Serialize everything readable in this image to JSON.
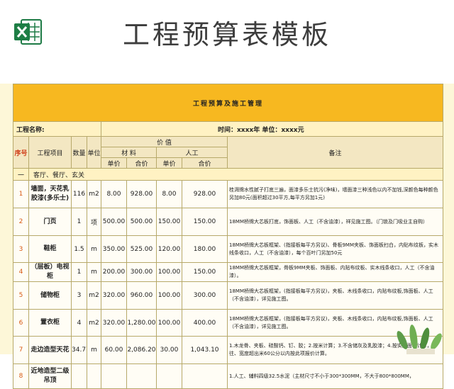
{
  "header": {
    "title": "工程预算表模板",
    "app_icon": "excel-icon"
  },
  "sheet": {
    "title": "工程预算及施工管理",
    "project_label": "工程名称:",
    "info_right": "时间：xxxx年    单位：xxxx元",
    "columns": {
      "seq": "序号",
      "item": "工程项目",
      "qty": "数量",
      "unit": "单位",
      "value": "价          值",
      "material": "材          料",
      "labor": "人工",
      "unit_price": "单价",
      "total": "合价",
      "note": "备注"
    },
    "section_label": "一",
    "section_name": "客厅、餐厅、玄关",
    "rows": [
      {
        "seq": "1",
        "name": "墙面，天花乳胶漆(多乐士)",
        "qty": "116",
        "unit": "m2",
        "mat_price": "8.00",
        "mat_total": "928.00",
        "lab_price": "8.00",
        "lab_total": "928.00",
        "note": "桂湃牌水性腻子打底三遍，面漆多乐士抗污(净味)，墙面漆三种浅色以内不加钱,深颜色每种颜色另加80元(面积超过30平方,每平方另加1元)"
      },
      {
        "seq": "2",
        "name": "门页",
        "qty": "1",
        "unit": "项",
        "mat_price": "500.00",
        "mat_total": "500.00",
        "lab_price": "150.00",
        "lab_total": "150.00",
        "note": "18MM桥牌大芯板打底，饰面板、人工（不含油漆），祥见施工图。（门锁及门吸业主自购）"
      },
      {
        "seq": "3",
        "name": "鞋柜",
        "qty": "1.5",
        "unit": "m",
        "mat_price": "350.00",
        "mat_total": "525.00",
        "lab_price": "120.00",
        "lab_total": "180.00",
        "note": "18MM桥牌大芯板框架、(指接板每平方另议)、骨板9MM夹板、饰面板扫白，内贴布纹板，实木线条收口，人工（不含油漆），每个百叶门另加50元"
      },
      {
        "seq": "4",
        "name": "（层板）电视柜",
        "qty": "1",
        "unit": "m",
        "mat_price": "200.00",
        "mat_total": "300.00",
        "lab_price": "100.00",
        "lab_total": "150.00",
        "note": "18MM桥牌大芯板框架，骨板9MM夹板、饰面板、内贴布纹板、实木线条收口，人工（不含油漆）。"
      },
      {
        "seq": "5",
        "name": "储物柜",
        "qty": "3",
        "unit": "m2",
        "mat_price": "320.00",
        "mat_total": "960.00",
        "lab_price": "100.00",
        "lab_total": "300.00",
        "note": "18MM桥牌大芯板框架，(指接板每平方另议)，夹板、木线条收口，内贴布纹板,饰面板、人工（不含油漆），详见施工图。"
      },
      {
        "seq": "6",
        "name": "置衣柜",
        "qty": "4",
        "unit": "m2",
        "mat_price": "320.00",
        "mat_total": "1,280.00",
        "lab_price": "100.00",
        "lab_total": "400.00",
        "note": "18MM桥牌大芯板框架，(指接板每平方另议)，夹板、木线条收口，内贴布纹板,饰面板、人工（不含油漆），详见施工图。"
      },
      {
        "seq": "7",
        "name": "走边造型天花",
        "qty": "34.77",
        "unit": "m",
        "mat_price": "60.00",
        "mat_total": "2,086.20",
        "lab_price": "30.00",
        "lab_total": "1,043.10",
        "note": "1.木龙骨、夹板、硅酸钙、钉、胶；2.按米计算；3.不含储灰及乳胶漆；4.按实际面积计算，往、宽度超出米60公分以内按此项报价计算。"
      },
      {
        "seq": "8",
        "name": "近地造型二级吊顶",
        "qty": "",
        "unit": "",
        "mat_price": "",
        "mat_total": "",
        "lab_price": "",
        "lab_total": "",
        "note": "1.人工、辅料四级32.5水泥（主材尺寸不小于300*300MM，不大于800*800MM，"
      }
    ]
  }
}
